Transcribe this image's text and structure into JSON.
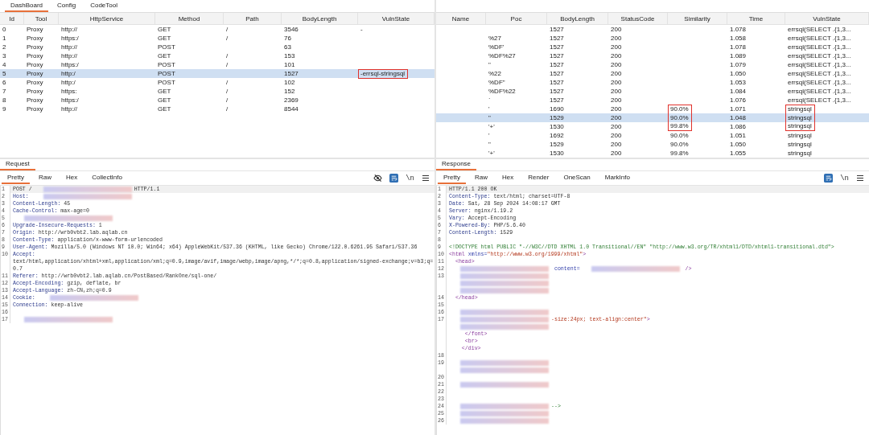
{
  "main_tabs": [
    {
      "label": "DashBoard",
      "selected": true
    },
    {
      "label": "Config",
      "selected": false
    },
    {
      "label": "CodeTool",
      "selected": false
    }
  ],
  "request_table": {
    "columns": [
      "Id",
      "Tool",
      "HttpService",
      "Method",
      "Path",
      "BodyLength",
      "VulnState"
    ],
    "rows": [
      {
        "cells": [
          "0",
          "Proxy",
          "http://",
          "GET",
          "/",
          "3546",
          "-"
        ],
        "selected": false,
        "flagged": false
      },
      {
        "cells": [
          "1",
          "Proxy",
          "https:/",
          "GET",
          "/",
          "76",
          null
        ],
        "selected": false,
        "flagged": false
      },
      {
        "cells": [
          "2",
          "Proxy",
          "http://",
          "POST",
          null,
          "63",
          null
        ],
        "selected": false,
        "flagged": false
      },
      {
        "cells": [
          "3",
          "Proxy",
          "http://",
          "GET",
          "/",
          "153",
          null
        ],
        "selected": false,
        "flagged": false
      },
      {
        "cells": [
          "4",
          "Proxy",
          "https:/",
          "POST",
          "/",
          "101",
          null
        ],
        "selected": false,
        "flagged": false
      },
      {
        "cells": [
          "5",
          "Proxy",
          "http:/",
          "POST",
          null,
          "1527",
          "-errsql-stringsql"
        ],
        "selected": true,
        "flagged": true
      },
      {
        "cells": [
          "6",
          "Proxy",
          "http:/",
          "POST",
          "/",
          "102",
          null
        ],
        "selected": false,
        "flagged": false
      },
      {
        "cells": [
          "7",
          "Proxy",
          "https:",
          "GET",
          "/",
          "152",
          null
        ],
        "selected": false,
        "flagged": false
      },
      {
        "cells": [
          "8",
          "Proxy",
          "https:/",
          "GET",
          "/",
          "2369",
          null
        ],
        "selected": false,
        "flagged": false
      },
      {
        "cells": [
          "9",
          "Proxy",
          "http://",
          "GET",
          "/",
          "8544",
          null
        ],
        "selected": false,
        "flagged": false
      }
    ]
  },
  "scan_table": {
    "columns": [
      "Name",
      "Poc",
      "BodyLength",
      "StatusCode",
      "Similarity",
      "Time",
      "VulnState"
    ],
    "rows": [
      {
        "cells": [
          null,
          null,
          "1527",
          "200",
          null,
          "1.078",
          "errsql(SELECT .{1,3..."
        ],
        "selected": false,
        "flagged": false
      },
      {
        "cells": [
          null,
          "%27",
          "1527",
          "200",
          null,
          "1.058",
          "errsql(SELECT .{1,3..."
        ],
        "selected": false,
        "flagged": false
      },
      {
        "cells": [
          null,
          "%DF'",
          "1527",
          "200",
          null,
          "1.078",
          "errsql(SELECT .{1,3..."
        ],
        "selected": false,
        "flagged": false
      },
      {
        "cells": [
          null,
          "%DF%27",
          "1527",
          "200",
          null,
          "1.089",
          "errsql(SELECT .{1,3..."
        ],
        "selected": false,
        "flagged": false
      },
      {
        "cells": [
          null,
          "\"",
          "1527",
          "200",
          null,
          "1.079",
          "errsql(SELECT .{1,3..."
        ],
        "selected": false,
        "flagged": false
      },
      {
        "cells": [
          null,
          "%22",
          "1527",
          "200",
          null,
          "1.050",
          "errsql(SELECT .{1,3..."
        ],
        "selected": false,
        "flagged": false
      },
      {
        "cells": [
          null,
          "%DF\"",
          "1527",
          "200",
          null,
          "1.053",
          "errsql(SELECT .{1,3..."
        ],
        "selected": false,
        "flagged": false
      },
      {
        "cells": [
          null,
          "%DF%22",
          "1527",
          "200",
          null,
          "1.084",
          "errsql(SELECT .{1,3..."
        ],
        "selected": false,
        "flagged": false
      },
      {
        "cells": [
          null,
          "`",
          "1527",
          "200",
          null,
          "1.076",
          "errsql(SELECT .{1,3..."
        ],
        "selected": false,
        "flagged": false
      },
      {
        "cells": [
          null,
          "'",
          "1690",
          "200",
          "90.0%",
          "1.071",
          "stringsql"
        ],
        "selected": false,
        "flagged": true
      },
      {
        "cells": [
          null,
          "\"",
          "1529",
          "200",
          "90.0%",
          "1.048",
          "stringsql"
        ],
        "selected": true,
        "flagged": true
      },
      {
        "cells": [
          null,
          "'+'",
          "1530",
          "200",
          "99.8%",
          "1.086",
          "stringsql"
        ],
        "selected": false,
        "flagged": true
      },
      {
        "cells": [
          null,
          "'",
          "1692",
          "200",
          "90.0%",
          "1.051",
          "stringsql"
        ],
        "selected": false,
        "flagged": false
      },
      {
        "cells": [
          null,
          "\"",
          "1529",
          "200",
          "90.0%",
          "1.050",
          "stringsql"
        ],
        "selected": false,
        "flagged": false
      },
      {
        "cells": [
          null,
          "'+'",
          "1530",
          "200",
          "99.8%",
          "1.055",
          "stringsql"
        ],
        "selected": false,
        "flagged": false
      }
    ]
  },
  "request": {
    "title": "Request",
    "tabs": [
      {
        "label": "Pretty",
        "selected": true
      },
      {
        "label": "Raw",
        "selected": false
      },
      {
        "label": "Hex",
        "selected": false
      },
      {
        "label": "CollectInfo",
        "selected": false
      }
    ],
    "toolbar": [
      {
        "kind": "hide"
      },
      {
        "kind": "wrap",
        "on": true
      },
      {
        "kind": "text",
        "label": "\\n"
      },
      {
        "kind": "menu"
      }
    ],
    "lines": [
      {
        "number": "1",
        "parts": [
          {
            "kind": "plain",
            "text": "POST /"
          },
          {
            "kind": "redacted"
          },
          {
            "kind": "plain",
            "text": "HTTP/1.1"
          }
        ]
      },
      {
        "number": "2",
        "parts": [
          {
            "kind": "name",
            "text": "Host:"
          },
          {
            "kind": "redacted"
          }
        ]
      },
      {
        "number": "3",
        "parts": [
          {
            "kind": "name",
            "text": "Content-Length:"
          },
          {
            "kind": "value",
            "text": "45"
          }
        ]
      },
      {
        "number": "4",
        "parts": [
          {
            "kind": "name",
            "text": "Cache-Control:"
          },
          {
            "kind": "value",
            "text": "max-age=0"
          }
        ]
      },
      {
        "number": "5",
        "parts": [
          {
            "kind": "redacted"
          }
        ]
      },
      {
        "number": "6",
        "parts": [
          {
            "kind": "name",
            "text": "Upgrade-Insecure-Requests:"
          },
          {
            "kind": "value",
            "text": "1"
          }
        ]
      },
      {
        "number": "7",
        "parts": [
          {
            "kind": "name",
            "text": "Origin:"
          },
          {
            "kind": "value",
            "text": "http://wrb0vbt2.lab.aqlab.cn"
          }
        ]
      },
      {
        "number": "8",
        "parts": [
          {
            "kind": "name",
            "text": "Content-Type:"
          },
          {
            "kind": "value",
            "text": "application/x-www-form-urlencoded"
          }
        ]
      },
      {
        "number": "9",
        "parts": [
          {
            "kind": "name",
            "text": "User-Agent:"
          },
          {
            "kind": "value",
            "text": "Mozilla/5.0 (Windows NT 10.0; Win64; x64) AppleWebKit/537.36 (KHTML, like Gecko) Chrome/122.0.6261.95 Safari/537.36"
          }
        ]
      },
      {
        "number": "10",
        "parts": [
          {
            "kind": "name",
            "text": "Accept:"
          }
        ]
      },
      {
        "parts": [
          {
            "kind": "value",
            "text": "text/html,application/xhtml+xml,application/xml;q=0.9,image/avif,image/webp,image/apng,*/*;q=0.8,application/signed-exchange;v=b3;q=0.7"
          }
        ]
      },
      {
        "number": "11",
        "parts": [
          {
            "kind": "name",
            "text": "Referer:"
          },
          {
            "kind": "value",
            "text": "http://wrb0vbt2.lab.aqlab.cn/PostBased/RankOne/sql-one/"
          }
        ]
      },
      {
        "number": "12",
        "parts": [
          {
            "kind": "name",
            "text": "Accept-Encoding:"
          },
          {
            "kind": "value",
            "text": "gzip, deflate, br"
          }
        ]
      },
      {
        "number": "13",
        "parts": [
          {
            "kind": "name",
            "text": "Accept-Language:"
          },
          {
            "kind": "value",
            "text": "zh-CN,zh;q=0.9"
          }
        ]
      },
      {
        "number": "14",
        "parts": [
          {
            "kind": "name",
            "text": "Cookie:"
          },
          {
            "kind": "redacted"
          }
        ]
      },
      {
        "number": "15",
        "parts": [
          {
            "kind": "name",
            "text": "Connection:"
          },
          {
            "kind": "value",
            "text": "keep-alive"
          }
        ]
      },
      {
        "number": "16"
      },
      {
        "number": "17",
        "parts": [
          {
            "kind": "redacted"
          }
        ]
      }
    ]
  },
  "response": {
    "title": "Response",
    "tabs": [
      {
        "label": "Pretty",
        "selected": true
      },
      {
        "label": "Raw",
        "selected": false
      },
      {
        "label": "Hex",
        "selected": false
      },
      {
        "label": "Render",
        "selected": false
      },
      {
        "label": "OneScan",
        "selected": false
      },
      {
        "label": "MarkInfo",
        "selected": false
      }
    ],
    "toolbar": [
      {
        "kind": "wrap",
        "on": true
      },
      {
        "kind": "text",
        "label": "\\n"
      },
      {
        "kind": "menu"
      }
    ],
    "lines": [
      {
        "number": "1",
        "parts": [
          {
            "kind": "plain",
            "text": "HTTP/1.1 200 OK"
          }
        ]
      },
      {
        "number": "2",
        "parts": [
          {
            "kind": "name",
            "text": "Content-Type:"
          },
          {
            "kind": "value",
            "text": "text/html; charset=UTF-8"
          }
        ]
      },
      {
        "number": "3",
        "parts": [
          {
            "kind": "name",
            "text": "Date:"
          },
          {
            "kind": "value",
            "text": "Sat, 28 Sep 2024 14:08:17 GMT"
          }
        ]
      },
      {
        "number": "4",
        "parts": [
          {
            "kind": "name",
            "text": "Server:"
          },
          {
            "kind": "value",
            "text": "nginx/1.19.2"
          }
        ]
      },
      {
        "number": "5",
        "parts": [
          {
            "kind": "name",
            "text": "Vary:"
          },
          {
            "kind": "value",
            "text": "Accept-Encoding"
          }
        ]
      },
      {
        "number": "6",
        "parts": [
          {
            "kind": "name",
            "text": "X-Powered-By:"
          },
          {
            "kind": "value",
            "text": "PHP/5.6.40"
          }
        ]
      },
      {
        "number": "7",
        "parts": [
          {
            "kind": "name",
            "text": "Content-Length:"
          },
          {
            "kind": "value",
            "text": "1529"
          }
        ]
      },
      {
        "number": "8"
      },
      {
        "number": "9",
        "parts": [
          {
            "kind": "doctype",
            "text": "<!DOCTYPE html PUBLIC \"-//W3C//DTD XHTML 1.0 Transitional//EN\" \"http://www.w3.org/TR/xhtml1/DTD/xhtml1-transitional.dtd\">"
          }
        ]
      },
      {
        "number": "10",
        "parts": [
          {
            "kind": "tag",
            "text": "<html"
          },
          {
            "kind": "attr",
            "text": " xmlns="
          },
          {
            "kind": "string",
            "text": "\"http://www.w3.org/1999/xhtml\""
          },
          {
            "kind": "tag",
            "text": ">"
          }
        ]
      },
      {
        "number": "11",
        "parts": [
          {
            "kind": "tag",
            "text": "  <head>"
          }
        ]
      },
      {
        "number": "12",
        "parts": [
          {
            "kind": "redacted"
          },
          {
            "kind": "attr",
            "text": " content="
          },
          {
            "kind": "redacted"
          },
          {
            "kind": "tag",
            "text": " />"
          }
        ]
      },
      {
        "number": "13",
        "parts": [
          {
            "kind": "redacted"
          }
        ]
      },
      {
        "parts": [
          {
            "kind": "redacted"
          }
        ]
      },
      {
        "parts": [
          {
            "kind": "redacted"
          }
        ]
      },
      {
        "number": "14",
        "parts": [
          {
            "kind": "tag",
            "text": "  </head>"
          }
        ]
      },
      {
        "number": "15"
      },
      {
        "number": "16",
        "parts": [
          {
            "kind": "redacted"
          }
        ]
      },
      {
        "number": "17",
        "parts": [
          {
            "kind": "redacted"
          },
          {
            "kind": "string",
            "text": "-size:24px; text-align:center\""
          },
          {
            "kind": "tag",
            "text": ">"
          }
        ]
      },
      {
        "parts": [
          {
            "kind": "redacted"
          }
        ]
      },
      {
        "parts": [
          {
            "kind": "tag",
            "text": "     </font>"
          }
        ]
      },
      {
        "parts": [
          {
            "kind": "tag",
            "text": "     <br>"
          }
        ]
      },
      {
        "parts": [
          {
            "kind": "tag",
            "text": "    </div>"
          }
        ]
      },
      {
        "number": "18"
      },
      {
        "number": "19",
        "parts": [
          {
            "kind": "redacted"
          }
        ]
      },
      {
        "parts": [
          {
            "kind": "redacted"
          }
        ]
      },
      {
        "number": "20"
      },
      {
        "number": "21",
        "parts": [
          {
            "kind": "redacted"
          }
        ]
      },
      {
        "number": "22"
      },
      {
        "number": "23"
      },
      {
        "number": "24",
        "parts": [
          {
            "kind": "redacted"
          },
          {
            "kind": "doctype",
            "text": "-->"
          }
        ]
      },
      {
        "number": "25",
        "parts": [
          {
            "kind": "redacted"
          }
        ]
      },
      {
        "number": "26",
        "parts": [
          {
            "kind": "redacted"
          }
        ]
      }
    ]
  }
}
